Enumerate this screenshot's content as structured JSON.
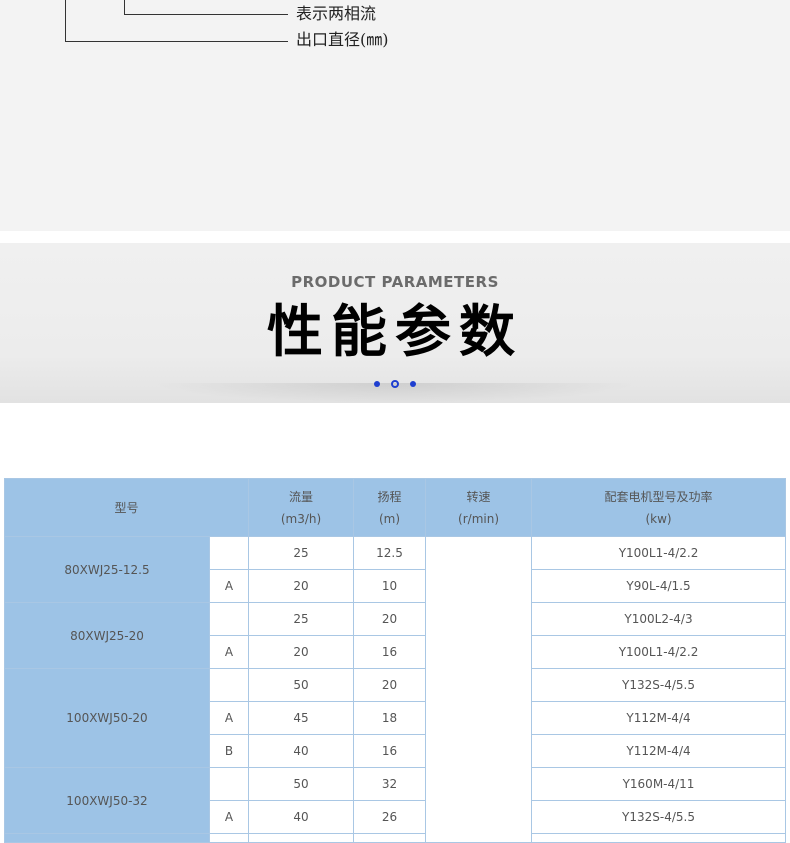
{
  "diagram": {
    "labels": [
      "表示两相流",
      "出口直径(㎜)"
    ]
  },
  "banner": {
    "subtitle": "PRODUCT PARAMETERS",
    "title": "性能参数",
    "accent_color": "#1f3fd0"
  },
  "table": {
    "header_color": "#9dc3e6",
    "headers": {
      "model": "型号",
      "flow": "流量",
      "flow_unit": "(m3/h)",
      "head": "扬程",
      "head_unit": "(m)",
      "speed": "转速",
      "speed_unit": "(r/min)",
      "motor": "配套电机型号及功率",
      "motor_unit": "(kw)"
    },
    "groups": [
      {
        "model": "80XWJ25-12.5",
        "rows": [
          {
            "variant": "",
            "flow": "25",
            "head": "12.5",
            "motor": "Y100L1-4/2.2"
          },
          {
            "variant": "A",
            "flow": "20",
            "head": "10",
            "motor": "Y90L-4/1.5"
          }
        ]
      },
      {
        "model": "80XWJ25-20",
        "rows": [
          {
            "variant": "",
            "flow": "25",
            "head": "20",
            "motor": "Y100L2-4/3"
          },
          {
            "variant": "A",
            "flow": "20",
            "head": "16",
            "motor": "Y100L1-4/2.2"
          }
        ]
      },
      {
        "model": "100XWJ50-20",
        "rows": [
          {
            "variant": "",
            "flow": "50",
            "head": "20",
            "motor": "Y132S-4/5.5"
          },
          {
            "variant": "A",
            "flow": "45",
            "head": "18",
            "motor": "Y112M-4/4"
          },
          {
            "variant": "B",
            "flow": "40",
            "head": "16",
            "motor": "Y112M-4/4"
          }
        ]
      },
      {
        "model": "100XWJ50-32",
        "rows": [
          {
            "variant": "",
            "flow": "50",
            "head": "32",
            "motor": "Y160M-4/11"
          },
          {
            "variant": "A",
            "flow": "40",
            "head": "26",
            "motor": "Y132S-4/5.5"
          }
        ]
      }
    ]
  }
}
